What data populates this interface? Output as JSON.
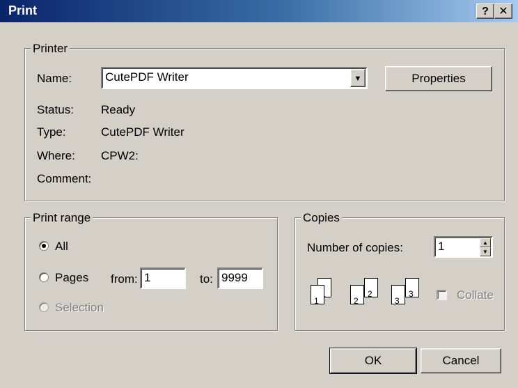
{
  "window": {
    "title": "Print",
    "help_glyph": "?",
    "close_glyph": "✕"
  },
  "printer": {
    "group_label": "Printer",
    "name_label": "Name:",
    "name_value": "CutePDF Writer",
    "properties_label": "Properties",
    "status_label": "Status:",
    "status_value": "Ready",
    "type_label": "Type:",
    "type_value": "CutePDF Writer",
    "where_label": "Where:",
    "where_value": "CPW2:",
    "comment_label": "Comment:",
    "comment_value": ""
  },
  "print_range": {
    "group_label": "Print range",
    "all_label": "All",
    "pages_label": "Pages",
    "from_label": "from:",
    "from_value": "1",
    "to_label": "to:",
    "to_value": "9999",
    "selection_label": "Selection",
    "selected": "all"
  },
  "copies": {
    "group_label": "Copies",
    "number_label": "Number of copies:",
    "number_value": "1",
    "collate_label": "Collate",
    "collate_checked": false,
    "collate_pages": [
      {
        "back": "1",
        "front": "1"
      },
      {
        "back": "2",
        "front": "2"
      },
      {
        "back": "3",
        "front": "3"
      }
    ]
  },
  "buttons": {
    "ok_label": "OK",
    "cancel_label": "Cancel"
  },
  "colors": {
    "face": "#d4d0c8",
    "title_start": "#0a246a",
    "title_end": "#a6caf0"
  },
  "icons": {
    "dropdown": "chevron-down-icon",
    "spin_up": "up-arrow-icon",
    "spin_down": "down-arrow-icon"
  }
}
